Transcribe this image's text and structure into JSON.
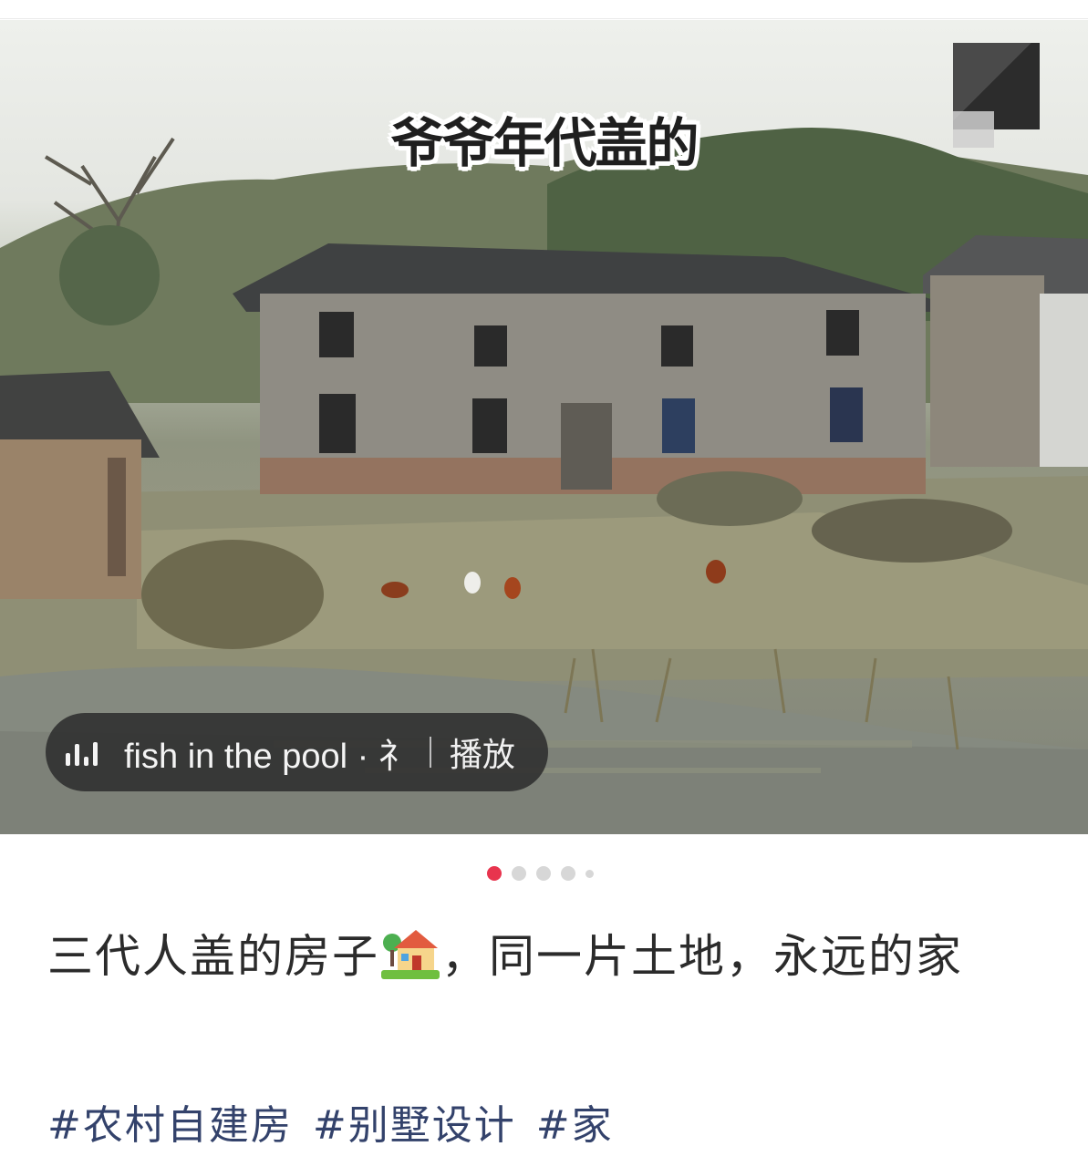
{
  "photo": {
    "caption": "爷爷年代盖的",
    "music": {
      "title": "fish in the pool · 礻",
      "play_label": "播放",
      "icon": "music-bars-icon"
    }
  },
  "pager": {
    "count": 5,
    "active_index": 0,
    "active_color": "#e8344e"
  },
  "post": {
    "title_part1": "三代人盖的房子",
    "title_emoji": "house-with-garden-icon",
    "title_part2": "，同一片土地，永远的家",
    "tags": [
      "#农村自建房",
      "#别墅设计",
      "#家"
    ]
  }
}
